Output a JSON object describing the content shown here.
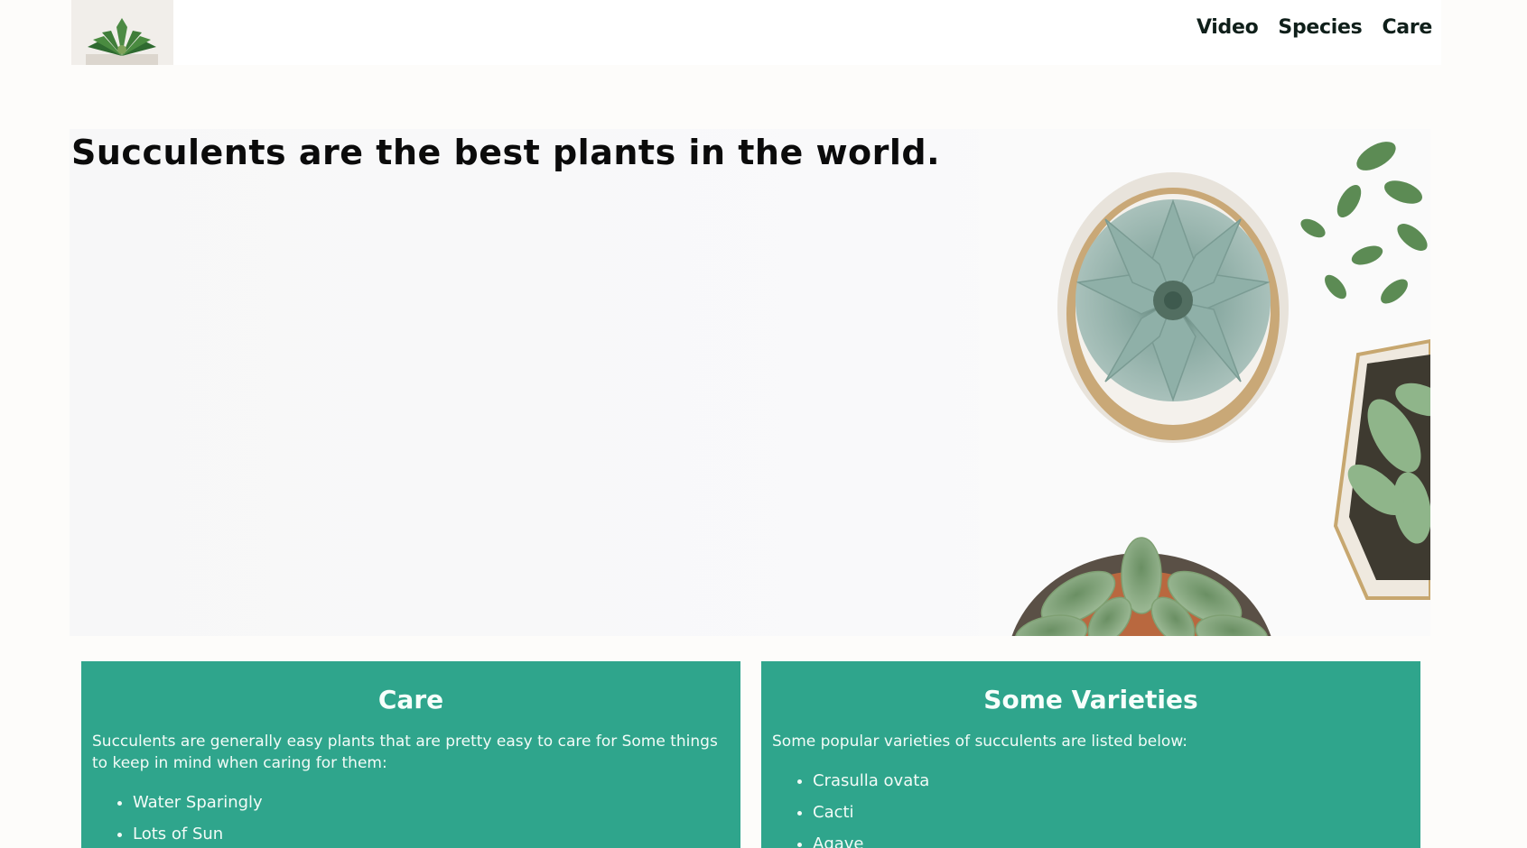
{
  "header": {
    "logo_alt": "succulent logo",
    "nav": [
      "Video",
      "Species",
      "Care"
    ]
  },
  "hero": {
    "title": "Succulents are the best plants in the world."
  },
  "care": {
    "title": "Care",
    "intro": "Succulents are generally easy plants that are pretty easy to care for Some things to keep in mind when caring for them:",
    "items": [
      "Water Sparingly",
      "Lots of Sun"
    ]
  },
  "varieties": {
    "title": "Some Varieties",
    "intro": "Some popular varieties of succulents are listed below:",
    "items": [
      "Crasulla ovata",
      "Cacti",
      "Agave"
    ]
  },
  "colors": {
    "card_bg": "#2fa58c",
    "page_bg": "#fdfcfa"
  }
}
